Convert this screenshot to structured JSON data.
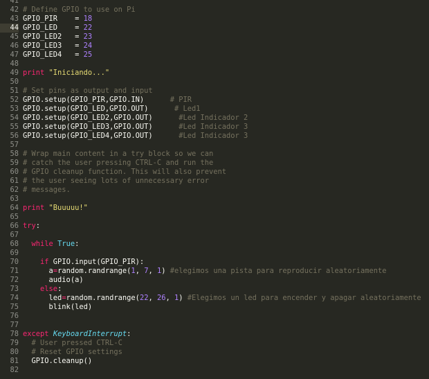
{
  "editor": {
    "active_line": "44",
    "lines": [
      {
        "n": "41",
        "t": []
      },
      {
        "n": "42",
        "t": [
          [
            "c",
            "# Define GPIO to use on Pi"
          ]
        ]
      },
      {
        "n": "43",
        "t": [
          [
            "p",
            "GPIO_PIR    = "
          ],
          [
            "n",
            "18"
          ]
        ]
      },
      {
        "n": "44",
        "t": [
          [
            "p",
            "GPIO_LED    = "
          ],
          [
            "n",
            "22"
          ]
        ]
      },
      {
        "n": "45",
        "t": [
          [
            "p",
            "GPIO_LED2   = "
          ],
          [
            "n",
            "23"
          ]
        ]
      },
      {
        "n": "46",
        "t": [
          [
            "p",
            "GPIO_LED3   = "
          ],
          [
            "n",
            "24"
          ]
        ]
      },
      {
        "n": "47",
        "t": [
          [
            "p",
            "GPIO_LED4   = "
          ],
          [
            "n",
            "25"
          ]
        ]
      },
      {
        "n": "48",
        "t": []
      },
      {
        "n": "49",
        "t": [
          [
            "k",
            "print"
          ],
          [
            "p",
            " "
          ],
          [
            "s",
            "\"Iniciando...\""
          ]
        ]
      },
      {
        "n": "50",
        "t": []
      },
      {
        "n": "51",
        "t": [
          [
            "c",
            "# Set pins as output and input"
          ]
        ]
      },
      {
        "n": "52",
        "t": [
          [
            "p",
            "GPIO.setup(GPIO_PIR,GPIO.IN)      "
          ],
          [
            "c",
            "# PIR"
          ]
        ]
      },
      {
        "n": "53",
        "t": [
          [
            "p",
            "GPIO.setup(GPIO_LED,GPIO.OUT)      "
          ],
          [
            "c",
            "# Led1"
          ]
        ]
      },
      {
        "n": "54",
        "t": [
          [
            "p",
            "GPIO.setup(GPIO_LED2,GPIO.OUT)      "
          ],
          [
            "c",
            "#Led Indicador 2"
          ]
        ]
      },
      {
        "n": "55",
        "t": [
          [
            "p",
            "GPIO.setup(GPIO_LED3,GPIO.OUT)      "
          ],
          [
            "c",
            "#Led Indicador 3"
          ]
        ]
      },
      {
        "n": "56",
        "t": [
          [
            "p",
            "GPIO.setup(GPIO_LED4,GPIO.OUT)      "
          ],
          [
            "c",
            "#Led Indicador 3"
          ]
        ]
      },
      {
        "n": "57",
        "t": []
      },
      {
        "n": "58",
        "t": [
          [
            "c",
            "# Wrap main content in a try block so we can"
          ]
        ]
      },
      {
        "n": "59",
        "t": [
          [
            "c",
            "# catch the user pressing CTRL-C and run the"
          ]
        ]
      },
      {
        "n": "60",
        "t": [
          [
            "c",
            "# GPIO cleanup function. This will also prevent"
          ]
        ]
      },
      {
        "n": "61",
        "t": [
          [
            "c",
            "# the user seeing lots of unnecessary error"
          ]
        ]
      },
      {
        "n": "62",
        "t": [
          [
            "c",
            "# messages."
          ]
        ]
      },
      {
        "n": "63",
        "t": []
      },
      {
        "n": "64",
        "t": [
          [
            "k",
            "print"
          ],
          [
            "p",
            " "
          ],
          [
            "s",
            "\"Buuuuu!\""
          ]
        ]
      },
      {
        "n": "65",
        "t": []
      },
      {
        "n": "66",
        "t": [
          [
            "k",
            "try"
          ],
          [
            "p",
            ":"
          ]
        ]
      },
      {
        "n": "67",
        "t": []
      },
      {
        "n": "68",
        "t": [
          [
            "p",
            "  "
          ],
          [
            "k",
            "while"
          ],
          [
            "p",
            " "
          ],
          [
            "b",
            "True"
          ],
          [
            "p",
            ":"
          ]
        ]
      },
      {
        "n": "69",
        "t": []
      },
      {
        "n": "70",
        "t": [
          [
            "p",
            "    "
          ],
          [
            "k",
            "if"
          ],
          [
            "p",
            " GPIO.input(GPIO_PIR):"
          ]
        ]
      },
      {
        "n": "71",
        "t": [
          [
            "p",
            "      a"
          ],
          [
            "k",
            "="
          ],
          [
            "p",
            "random.randrange("
          ],
          [
            "n",
            "1"
          ],
          [
            "p",
            ", "
          ],
          [
            "n",
            "7"
          ],
          [
            "p",
            ", "
          ],
          [
            "n",
            "1"
          ],
          [
            "p",
            ") "
          ],
          [
            "c",
            "#elegimos una pista para reproducir aleatoriamente"
          ]
        ]
      },
      {
        "n": "72",
        "t": [
          [
            "p",
            "      audio(a)"
          ]
        ]
      },
      {
        "n": "73",
        "t": [
          [
            "p",
            "    "
          ],
          [
            "k",
            "else"
          ],
          [
            "p",
            ":"
          ]
        ]
      },
      {
        "n": "74",
        "t": [
          [
            "p",
            "      led"
          ],
          [
            "k",
            "="
          ],
          [
            "p",
            "random.randrange("
          ],
          [
            "n",
            "22"
          ],
          [
            "p",
            ", "
          ],
          [
            "n",
            "26"
          ],
          [
            "p",
            ", "
          ],
          [
            "n",
            "1"
          ],
          [
            "p",
            ") "
          ],
          [
            "c",
            "#Elegimos un led para encender y apagar aleatoriamente"
          ]
        ]
      },
      {
        "n": "75",
        "t": [
          [
            "p",
            "      blink(led)"
          ]
        ]
      },
      {
        "n": "76",
        "t": []
      },
      {
        "n": "77",
        "t": []
      },
      {
        "n": "78",
        "t": [
          [
            "k",
            "except"
          ],
          [
            "p",
            " "
          ],
          [
            "i",
            "KeyboardInterrupt"
          ],
          [
            "p",
            ":"
          ]
        ]
      },
      {
        "n": "79",
        "t": [
          [
            "p",
            "  "
          ],
          [
            "c",
            "# User pressed CTRL-C"
          ]
        ]
      },
      {
        "n": "80",
        "t": [
          [
            "p",
            "  "
          ],
          [
            "c",
            "# Reset GPIO settings"
          ]
        ]
      },
      {
        "n": "81",
        "t": [
          [
            "p",
            "  GPIO.cleanup()"
          ]
        ]
      },
      {
        "n": "82",
        "t": []
      }
    ]
  }
}
